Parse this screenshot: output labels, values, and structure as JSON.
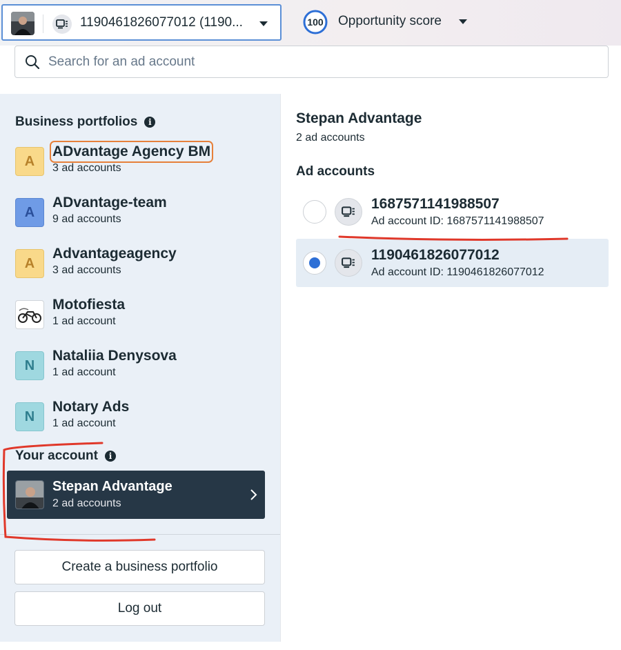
{
  "selector": {
    "account_label": "1190461826077012 (1190...",
    "opportunity_score": "100",
    "opportunity_label": "Opportunity score"
  },
  "search": {
    "placeholder": "Search for an ad account"
  },
  "left_panel": {
    "business_portfolios_title": "Business portfolios",
    "portfolios": [
      {
        "initial": "A",
        "name": "ADvantage Agency BM",
        "count": "3 ad accounts",
        "color": "#f9d98a",
        "text_color": "#b7812a"
      },
      {
        "initial": "A",
        "name": "ADvantage-team",
        "count": "9 ad accounts",
        "color": "#6f9be6",
        "text_color": "#2a4f9a"
      },
      {
        "initial": "A",
        "name": "Advantageagency",
        "count": "3 ad accounts",
        "color": "#f9d98a",
        "text_color": "#b7812a"
      },
      {
        "initial": "",
        "name": "Motofiesta",
        "count": "1 ad account",
        "color": "#ffffff",
        "text_color": "#000000"
      },
      {
        "initial": "N",
        "name": "Nataliia Denysova",
        "count": "1 ad account",
        "color": "#9fd8e0",
        "text_color": "#2f7e8e"
      },
      {
        "initial": "N",
        "name": "Notary Ads",
        "count": "1 ad account",
        "color": "#9fd8e0",
        "text_color": "#2f7e8e"
      }
    ],
    "your_account_title": "Your account",
    "your_account": {
      "name": "Stepan Advantage",
      "count": "2 ad accounts"
    },
    "create_button": "Create a business portfolio",
    "logout_button": "Log out"
  },
  "right_panel": {
    "title": "Stepan Advantage",
    "count": "2 ad accounts",
    "section_title": "Ad accounts",
    "accounts": [
      {
        "name": "1687571141988507",
        "id_text": "Ad account ID: 1687571141988507",
        "selected": false
      },
      {
        "name": "1190461826077012",
        "id_text": "Ad account ID: 1190461826077012",
        "selected": true
      }
    ]
  },
  "colors": {
    "accent_blue": "#2d6fd6",
    "annotation_red": "#e0382a",
    "dark_card": "#263746",
    "left_bg": "#eaf0f7"
  }
}
